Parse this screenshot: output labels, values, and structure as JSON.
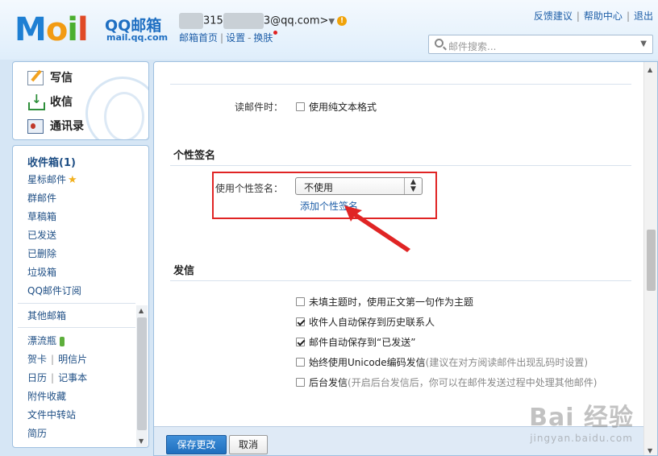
{
  "header": {
    "logo": {
      "m": "M",
      "o": "o",
      "i": "i",
      "l": "l",
      "cn": "QQ邮箱",
      "en": "mail.qq.com"
    },
    "account": {
      "prefix": "315",
      "suffix": "3@qq.com>"
    },
    "sub_links": {
      "home": "邮箱首页",
      "settings": "设置",
      "skin": "换肤",
      "sep": "|",
      "dash": "-"
    },
    "top_links": {
      "feedback": "反馈建议",
      "help": "帮助中心",
      "logout": "退出",
      "sep": "|"
    },
    "search": {
      "placeholder": "邮件搜索..."
    }
  },
  "sidebar": {
    "top_items": [
      {
        "label": "写信",
        "icon": "pencil-paper-icon"
      },
      {
        "label": "收信",
        "icon": "inbox-arrow-icon"
      },
      {
        "label": "通讯录",
        "icon": "contact-card-icon"
      }
    ],
    "folders": {
      "inbox": "收件箱(1)",
      "starred": "星标邮件",
      "group": "群邮件",
      "drafts": "草稿箱",
      "sent": "已发送",
      "deleted": "已删除",
      "spam": "垃圾箱",
      "subscribe": "QQ邮件订阅",
      "other": "其他邮箱",
      "bottle": "漂流瓶",
      "greeting": "贺卡",
      "postcard": "明信片",
      "calendar": "日历",
      "notes": "记事本",
      "favorites": "附件收藏",
      "transfer": "文件中转站",
      "resume": "简历",
      "pipe": "|"
    }
  },
  "main": {
    "read_label": "读邮件时：",
    "plain_text": "使用纯文本格式",
    "signature_section": "个性签名",
    "signature_label": "使用个性签名：",
    "signature_value": "不使用",
    "add_signature": "添加个性签名",
    "send_section": "发信",
    "options": [
      {
        "label": "未填主题时，使用正文第一句作为主题",
        "checked": false,
        "hint": ""
      },
      {
        "label": "收件人自动保存到历史联系人",
        "checked": true,
        "hint": ""
      },
      {
        "label": "邮件自动保存到“已发送”",
        "checked": true,
        "hint": ""
      },
      {
        "label": "始终使用Unicode编码发信",
        "checked": false,
        "hint": "(建议在对方阅读邮件出现乱码时设置)"
      },
      {
        "label": "后台发信",
        "checked": false,
        "hint": "(开启后台发信后，你可以在邮件发送过程中处理其他邮件)"
      }
    ],
    "save_button": "保存更改",
    "cancel_button": "取消"
  },
  "watermark": {
    "main": "Bai 经验",
    "sub": "jingyan.baidu.com"
  },
  "colors": {
    "brand_blue": "#1e7fd3",
    "link": "#1f5fa8",
    "highlight": "#e02424",
    "primary_button": "#2f7fcc"
  }
}
